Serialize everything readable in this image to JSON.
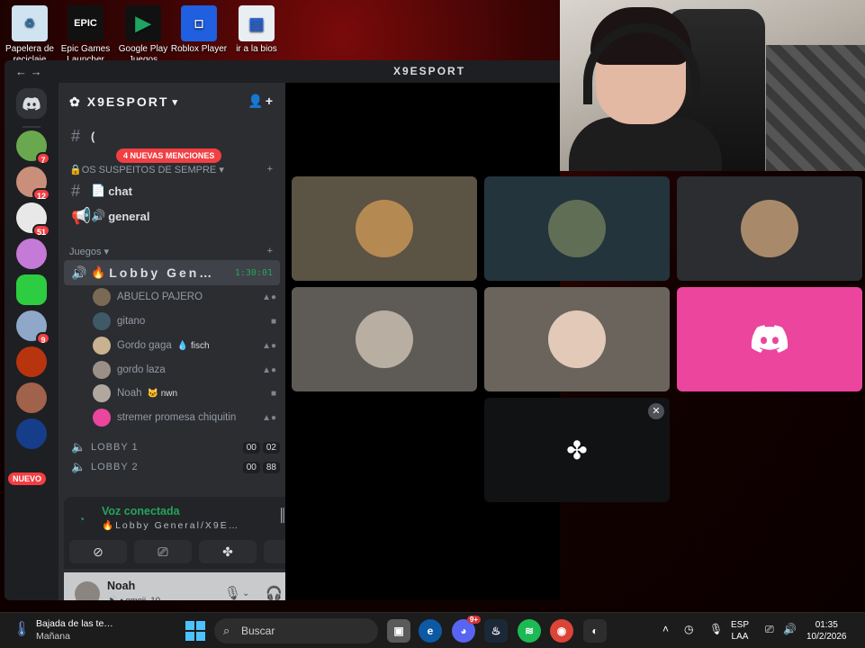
{
  "desktop": {
    "icons": [
      {
        "label": "Papelera de reciclaje",
        "icon": "recycle-bin-icon"
      },
      {
        "label": "Epic Games Launcher",
        "icon": "epic-games-icon",
        "glyph": "EPIC"
      },
      {
        "label": "Google Play Juegos",
        "icon": "google-play-games-icon"
      },
      {
        "label": "Roblox Player",
        "icon": "roblox-icon"
      },
      {
        "label": "ir a la bios",
        "icon": "shortcut-icon"
      }
    ]
  },
  "window": {
    "title": "X9ESPORT",
    "nav_back": "←",
    "nav_forward": "→"
  },
  "rail": {
    "servers": [
      {
        "badge": "7",
        "color": "#6aa84f"
      },
      {
        "badge": "12",
        "color": "#c98f7a"
      },
      {
        "badge": "51",
        "color": "#e8e8e8"
      },
      {
        "badge": "",
        "color": "#c47ad6"
      },
      {
        "badge": "",
        "color": "#2ecc40"
      },
      {
        "badge": "9",
        "color": "#8fa8c9"
      },
      {
        "badge": "",
        "color": "#b8340f"
      },
      {
        "badge": "",
        "color": "#a0624a"
      },
      {
        "badge": "",
        "color": "#153d8a"
      }
    ],
    "nuevo_label": "NUEVO"
  },
  "sidebar": {
    "server_name": "X9ESPORT",
    "mentions_pill": "4 NUEVAS MENCIONES",
    "top_channel_prefix": "(",
    "category1": "OS SUSPEITOS DE SEMPRE",
    "chat_channel": "chat",
    "general_channel": "general",
    "category2": "Juegos",
    "lobby_general": "Lobby Gen…",
    "lobby_time": "1:30:01",
    "voice_users": [
      {
        "name": "ABUELO PAJERO",
        "tag": "",
        "color": "#7a6a55"
      },
      {
        "name": "gitano",
        "tag": "",
        "color": "#3e5a66"
      },
      {
        "name": "Gordo gaga",
        "tag": "fisch",
        "color": "#c9b28f"
      },
      {
        "name": "gordo laza",
        "tag": "",
        "color": "#9a9088"
      },
      {
        "name": "Noah",
        "tag": "nwn",
        "color": "#b0a89f"
      },
      {
        "name": "stremer promesa chiquitin",
        "tag": "",
        "color": "#eb459e"
      }
    ],
    "lobby1": "LOBBY 1",
    "lobby1_counts": [
      "00",
      "02"
    ],
    "lobby2": "LOBBY 2",
    "lobby2_counts": [
      "00",
      "88"
    ]
  },
  "voice_panel": {
    "status": "Voz conectada",
    "channel": "Lobby General/X9E…"
  },
  "user_panel": {
    "name": "Noah",
    "status": "emoji_10"
  },
  "tiles": [
    {
      "bg": "#5b5343",
      "avatar": "#b58a52"
    },
    {
      "bg": "#23343c",
      "avatar": "#5f6e55"
    },
    {
      "bg": "#2b2d31",
      "avatar": "#a88a6a"
    },
    {
      "bg": "#5e5a55",
      "avatar": "#b8afa2"
    },
    {
      "bg": "#6a645c",
      "avatar": "#e2c9b8"
    },
    {
      "bg": "#eb459e",
      "avatar": "discord"
    }
  ],
  "taskbar": {
    "weather_line1": "Bajada de las te…",
    "weather_line2": "Mañana",
    "search_placeholder": "Buscar",
    "discord_badge": "9+",
    "lang_line1": "ESP",
    "lang_line2": "LAA",
    "time": "01:35",
    "date": "10/2/2026"
  }
}
